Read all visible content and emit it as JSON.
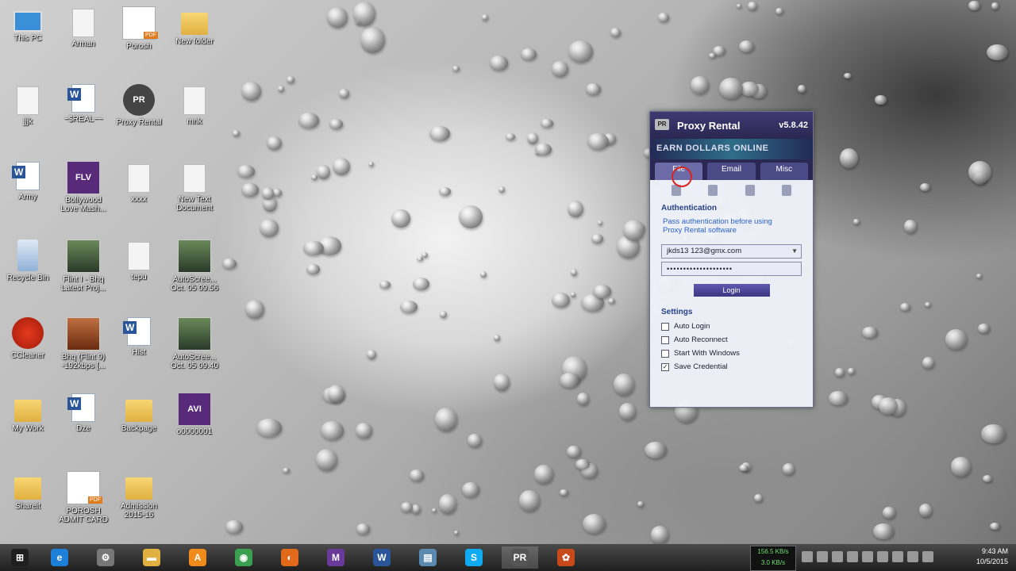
{
  "desktop": {
    "icons": [
      {
        "label": "This PC",
        "icon": "this-pc-icon"
      },
      {
        "label": "Arman",
        "icon": "file-icon"
      },
      {
        "label": "Porosh",
        "icon": "pdf-icon"
      },
      {
        "label": "New folder",
        "icon": "folder-icon"
      },
      {
        "label": "jjjk",
        "icon": "file-icon"
      },
      {
        "label": "~$REAL~~",
        "icon": "word-doc-icon"
      },
      {
        "label": "Proxy Rental",
        "icon": "proxy-rental-icon"
      },
      {
        "label": "mnk",
        "icon": "file-icon"
      },
      {
        "label": "Army",
        "icon": "word-doc-icon"
      },
      {
        "label": "Bollywood\nLove Mash...",
        "icon": "flv-video-icon"
      },
      {
        "label": "xxxx",
        "icon": "file-icon"
      },
      {
        "label": "New Text\nDocument",
        "icon": "text-document-icon"
      },
      {
        "label": "Recycle Bin",
        "icon": "recycle-bin-icon"
      },
      {
        "label": "Flint I - Bhq\nLatest Proj...",
        "icon": "video-thumbnail-icon"
      },
      {
        "label": "tepu",
        "icon": "file-icon"
      },
      {
        "label": "AutoScree...\nOct. 05 09.56",
        "icon": "screenshot-icon"
      },
      {
        "label": "CCleaner",
        "icon": "ccleaner-icon"
      },
      {
        "label": "Bhq (Flint 9)\n-192kbps [...",
        "icon": "photo-icon"
      },
      {
        "label": "Hist",
        "icon": "word-doc-icon"
      },
      {
        "label": "AutoScree...\nOct. 05 09.40",
        "icon": "screenshot-icon"
      },
      {
        "label": "My Work",
        "icon": "folder-icon"
      },
      {
        "label": "Dze",
        "icon": "word-doc-icon"
      },
      {
        "label": "Backpage",
        "icon": "folder-icon"
      },
      {
        "label": "o0000001",
        "icon": "avi-video-icon"
      },
      {
        "label": "Shareit",
        "icon": "folder-icon"
      },
      {
        "label": "POROSH\nADMIT CARD",
        "icon": "pdf-icon"
      },
      {
        "label": "Admission\n2015-16",
        "icon": "folder-icon"
      }
    ]
  },
  "proxy_window": {
    "title": "Proxy Rental",
    "version": "v5.8.42",
    "logo": "PR",
    "banner": "EARN DOLLARS ONLINE",
    "tabs": [
      "File",
      "Email",
      "Misc"
    ],
    "auth_heading": "Authentication",
    "auth_message": "Pass authentication before using\nProxy Rental software",
    "username": "jkds13 123@gmx.com",
    "password": "••••••••••••••••••••",
    "login_button": "Login",
    "settings_heading": "Settings",
    "settings": [
      {
        "label": "Auto Login",
        "checked": false
      },
      {
        "label": "Auto Reconnect",
        "checked": false
      },
      {
        "label": "Start With Windows",
        "checked": false
      },
      {
        "label": "Save Credential",
        "checked": true
      }
    ]
  },
  "taskbar": {
    "items": [
      {
        "name": "start-button",
        "glyph": "⊞",
        "color": "#1f1f1f"
      },
      {
        "name": "internet-explorer",
        "glyph": "e",
        "color": "#1e7fd8"
      },
      {
        "name": "app-tools",
        "glyph": "⚙",
        "color": "#777777"
      },
      {
        "name": "file-explorer",
        "glyph": "▬",
        "color": "#e0b040"
      },
      {
        "name": "avast",
        "glyph": "A",
        "color": "#f08a1a"
      },
      {
        "name": "chrome",
        "glyph": "◉",
        "color": "#3aa050"
      },
      {
        "name": "firefox",
        "glyph": "◐",
        "color": "#e06a1a"
      },
      {
        "name": "video-converter",
        "glyph": "M",
        "color": "#6a3a9a"
      },
      {
        "name": "word",
        "glyph": "W",
        "color": "#2a5699"
      },
      {
        "name": "network-app",
        "glyph": "▤",
        "color": "#5a8ab0"
      },
      {
        "name": "skype",
        "glyph": "S",
        "color": "#0faaf0"
      },
      {
        "name": "proxy-rental",
        "glyph": "PR",
        "color": "#555555"
      },
      {
        "name": "media-player",
        "glyph": "✿",
        "color": "#c84a1a"
      }
    ],
    "net_up": "156.5 KB/s",
    "net_down": "3.0 KB/s",
    "clock_time": "9:43 AM",
    "clock_date": "10/5/2015"
  }
}
